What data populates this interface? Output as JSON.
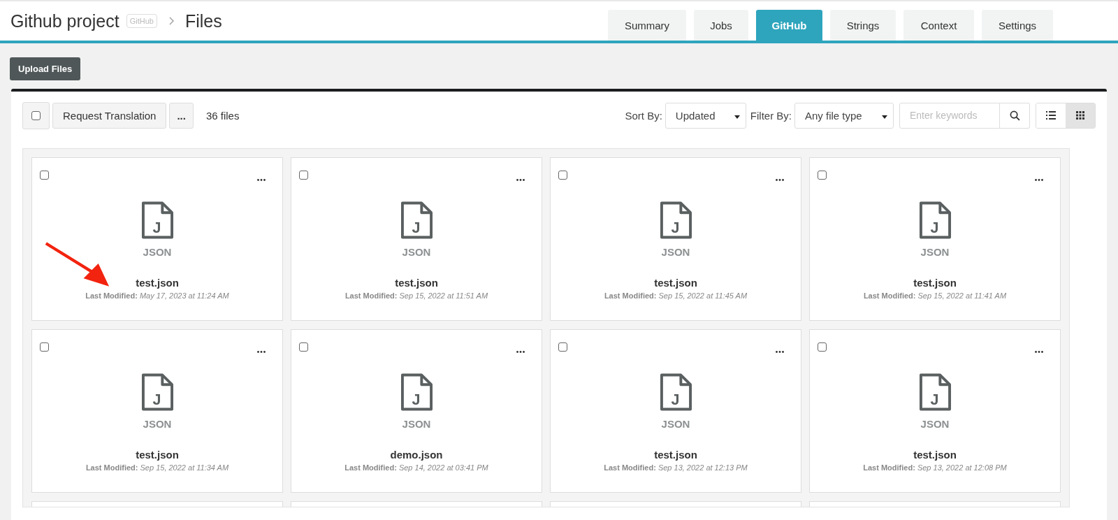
{
  "header": {
    "project": "Github project",
    "badge": "GitHub",
    "page": "Files"
  },
  "tabs": [
    {
      "label": "Summary",
      "selected": false
    },
    {
      "label": "Jobs",
      "selected": false
    },
    {
      "label": "GitHub",
      "selected": true
    },
    {
      "label": "Strings",
      "selected": false
    },
    {
      "label": "Context",
      "selected": false
    },
    {
      "label": "Settings",
      "selected": false
    }
  ],
  "upload_button": "Upload Files",
  "toolbar": {
    "select_all_checked": false,
    "request_button": "Request Translation",
    "more_button": "...",
    "count": "36 files",
    "sort_label": "Sort By:",
    "sort_value": "Updated",
    "filter_label": "Filter By:",
    "filter_value": "Any file type",
    "search_placeholder": "Enter keywords",
    "views": [
      {
        "kind": "list",
        "selected": false
      },
      {
        "kind": "grid",
        "selected": true
      }
    ]
  },
  "files": [
    {
      "checked": false,
      "type": "JSON",
      "letter": "J",
      "name": "test.json",
      "modified_label": "Last Modified:",
      "modified": "May 17, 2023 at 11:24 AM",
      "annotated": true
    },
    {
      "checked": false,
      "type": "JSON",
      "letter": "J",
      "name": "test.json",
      "modified_label": "Last Modified:",
      "modified": "Sep 15, 2022 at 11:51 AM",
      "annotated": false
    },
    {
      "checked": false,
      "type": "JSON",
      "letter": "J",
      "name": "test.json",
      "modified_label": "Last Modified:",
      "modified": "Sep 15, 2022 at 11:45 AM",
      "annotated": false
    },
    {
      "checked": false,
      "type": "JSON",
      "letter": "J",
      "name": "test.json",
      "modified_label": "Last Modified:",
      "modified": "Sep 15, 2022 at 11:41 AM",
      "annotated": false
    },
    {
      "checked": false,
      "type": "JSON",
      "letter": "J",
      "name": "test.json",
      "modified_label": "Last Modified:",
      "modified": "Sep 15, 2022 at 11:34 AM",
      "annotated": false
    },
    {
      "checked": false,
      "type": "JSON",
      "letter": "J",
      "name": "demo.json",
      "modified_label": "Last Modified:",
      "modified": "Sep 14, 2022 at 03:41 PM",
      "annotated": false
    },
    {
      "checked": false,
      "type": "JSON",
      "letter": "J",
      "name": "test.json",
      "modified_label": "Last Modified:",
      "modified": "Sep 13, 2022 at 12:13 PM",
      "annotated": false
    },
    {
      "checked": false,
      "type": "JSON",
      "letter": "J",
      "name": "test.json",
      "modified_label": "Last Modified:",
      "modified": "Sep 13, 2022 at 12:08 PM",
      "annotated": false
    }
  ]
}
